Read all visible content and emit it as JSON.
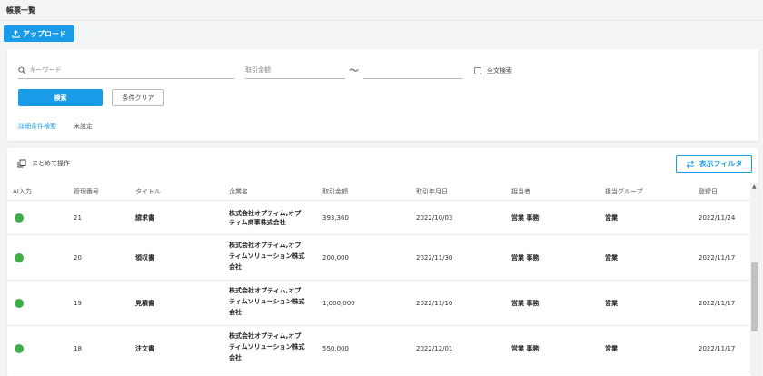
{
  "page": {
    "title": "帳票一覧"
  },
  "upload": {
    "label": "アップロード",
    "icon": "upload-icon"
  },
  "search": {
    "keyword_placeholder": "キーワード",
    "amount_placeholder": "取引金額",
    "range_separator": "〜",
    "fulltext_label": "全文検索",
    "search_button": "検索",
    "clear_button": "条件クリア",
    "advanced_link": "詳細条件検索",
    "advanced_status": "未設定"
  },
  "toolbar": {
    "bulk_label": "まとめて操作",
    "filter_label": "表示フィルタ"
  },
  "table": {
    "headers": {
      "ai": "AI入力",
      "id": "管理番号",
      "title": "タイトル",
      "company": "企業名",
      "amount": "取引金額",
      "date": "取引年月日",
      "assignee": "担当者",
      "group": "担当グループ",
      "registered": "登録日"
    },
    "status_color": "#3fae49",
    "rows": [
      {
        "id": "21",
        "title": "請求書",
        "company_l1": "株式会社オプティム,オプ",
        "company_l2": "ティム商事株式会社",
        "company_l3": "",
        "amount": "393,360",
        "date": "2022/10/03",
        "assignee": "営業 事務",
        "group": "営業",
        "registered": "2022/11/24"
      },
      {
        "id": "20",
        "title": "領収書",
        "company_l1": "株式会社オプティム,オプ",
        "company_l2": "ティムソリューション株式",
        "company_l3": "会社",
        "amount": "200,000",
        "date": "2022/11/30",
        "assignee": "営業 事務",
        "group": "営業",
        "registered": "2022/11/17"
      },
      {
        "id": "19",
        "title": "見積書",
        "company_l1": "株式会社オプティム,オプ",
        "company_l2": "ティムソリューション株式",
        "company_l3": "会社",
        "amount": "1,000,000",
        "date": "2022/11/10",
        "assignee": "営業 事務",
        "group": "営業",
        "registered": "2022/11/17"
      },
      {
        "id": "18",
        "title": "注文書",
        "company_l1": "株式会社オプティム,オプ",
        "company_l2": "ティムソリューション株式",
        "company_l3": "会社",
        "amount": "550,000",
        "date": "2022/12/01",
        "assignee": "営業 事務",
        "group": "営業",
        "registered": "2022/11/17"
      }
    ]
  }
}
